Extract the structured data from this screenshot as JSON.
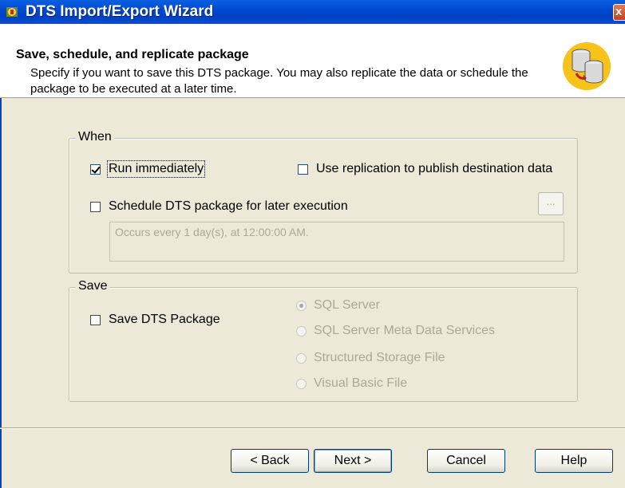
{
  "window": {
    "title": "DTS Import/Export Wizard",
    "close_label": "x"
  },
  "header": {
    "title": "Save, schedule, and replicate package",
    "description": "Specify if you want to save this DTS package.  You may also replicate the data or schedule the package to be executed at a later time.",
    "icon": "database-icon"
  },
  "when_group": {
    "legend": "When",
    "run_immediately": {
      "label": "Run immediately",
      "checked": true
    },
    "use_replication": {
      "label": "Use replication to publish destination data",
      "checked": false
    },
    "schedule": {
      "label": "Schedule DTS package for later execution",
      "checked": false
    },
    "schedule_button_label": "...",
    "schedule_text": "Occurs every 1 day(s), at 12:00:00 AM."
  },
  "save_group": {
    "legend": "Save",
    "save_package": {
      "label": "Save DTS Package",
      "checked": false
    },
    "options": [
      {
        "label": "SQL Server",
        "selected": true
      },
      {
        "label": "SQL Server Meta Data Services",
        "selected": false
      },
      {
        "label": "Structured Storage File",
        "selected": false
      },
      {
        "label": "Visual Basic File",
        "selected": false
      }
    ]
  },
  "buttons": {
    "back": "< Back",
    "next": "Next >",
    "cancel": "Cancel",
    "help": "Help"
  }
}
